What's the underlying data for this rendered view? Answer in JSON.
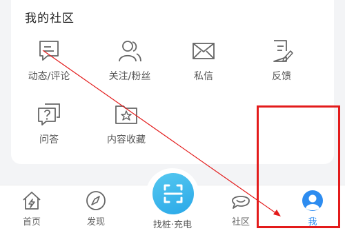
{
  "community": {
    "title": "我的社区",
    "items": [
      {
        "label": "动态/评论",
        "icon": "comment-icon"
      },
      {
        "label": "关注/粉丝",
        "icon": "users-icon"
      },
      {
        "label": "私信",
        "icon": "mail-icon"
      },
      {
        "label": "反馈",
        "icon": "feedback-icon"
      },
      {
        "label": "问答",
        "icon": "qa-icon"
      },
      {
        "label": "内容收藏",
        "icon": "favorites-icon"
      }
    ]
  },
  "tabbar": {
    "tabs": [
      {
        "label": "首页",
        "icon": "home-icon"
      },
      {
        "label": "发现",
        "icon": "compass-icon"
      },
      {
        "label": "找桩·充电",
        "icon": "scan-icon"
      },
      {
        "label": "社区",
        "icon": "chat-icon"
      },
      {
        "label": "我",
        "icon": "profile-icon",
        "active": true
      }
    ]
  },
  "colors": {
    "accent": "#2d8cf0",
    "center_button": "#2aa8e8",
    "annotation": "#e31b1b"
  }
}
